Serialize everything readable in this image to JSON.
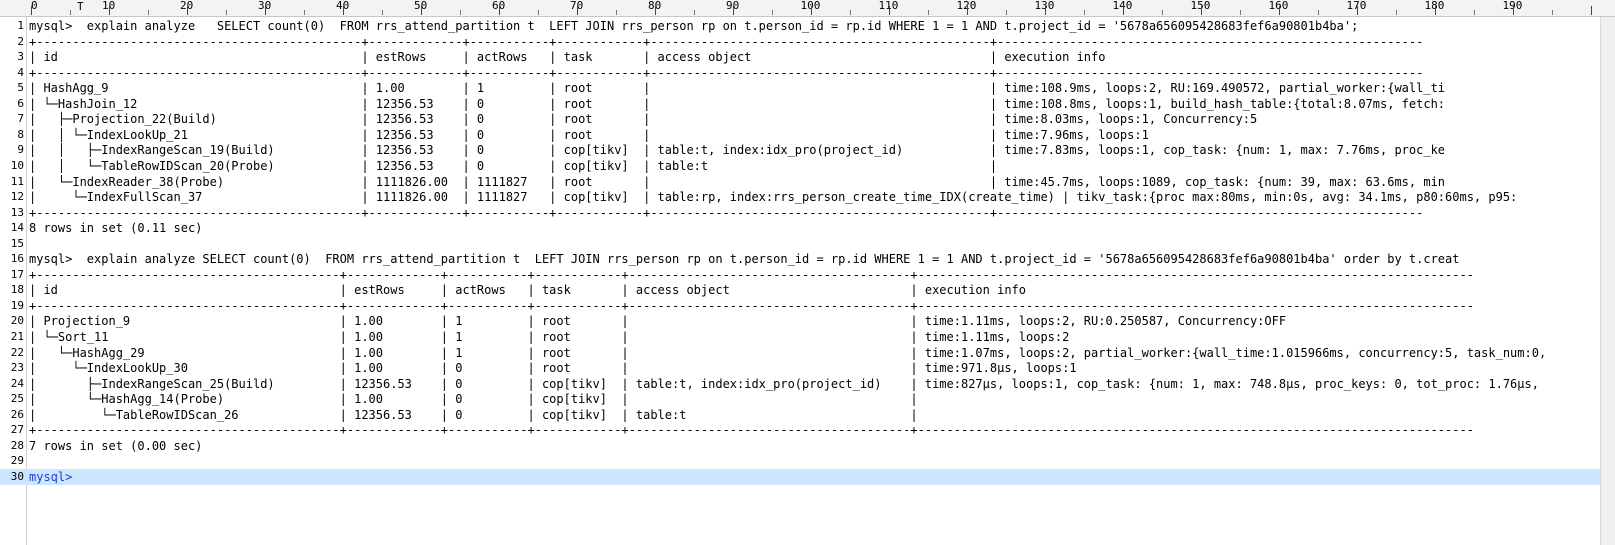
{
  "ruler": {
    "labels": [
      "0",
      "10",
      "20",
      "30",
      "40",
      "50",
      "60",
      "70",
      "80",
      "90",
      "100",
      "110",
      "120",
      "130",
      "140",
      "150",
      "160",
      "170",
      "180",
      "190"
    ],
    "tab_marker": "T"
  },
  "lines": [
    {
      "n": "1",
      "text": "mysql>  explain analyze   SELECT count(0)  FROM rrs_attend_partition t  LEFT JOIN rrs_person rp on t.person_id = rp.id WHERE 1 = 1 AND t.project_id = '5678a656095428683fef6a90801b4ba';"
    },
    {
      "n": "2",
      "text": "+---------------------------------------------+-------------+-----------+------------+-----------------------------------------------+-----------------------------------------------------------"
    },
    {
      "n": "3",
      "text": "| id                                          | estRows     | actRows   | task       | access object                                 | execution info"
    },
    {
      "n": "4",
      "text": "+---------------------------------------------+-------------+-----------+------------+-----------------------------------------------+-----------------------------------------------------------"
    },
    {
      "n": "5",
      "text": "| HashAgg_9                                   | 1.00        | 1         | root       |                                               | time:108.9ms, loops:2, RU:169.490572, partial_worker:{wall_ti"
    },
    {
      "n": "6",
      "text": "| └─HashJoin_12                               | 12356.53    | 0         | root       |                                               | time:108.8ms, loops:1, build_hash_table:{total:8.07ms, fetch:"
    },
    {
      "n": "7",
      "text": "|   ├─Projection_22(Build)                    | 12356.53    | 0         | root       |                                               | time:8.03ms, loops:1, Concurrency:5"
    },
    {
      "n": "8",
      "text": "|   │ └─IndexLookUp_21                        | 12356.53    | 0         | root       |                                               | time:7.96ms, loops:1"
    },
    {
      "n": "9",
      "text": "|   │   ├─IndexRangeScan_19(Build)            | 12356.53    | 0         | cop[tikv]  | table:t, index:idx_pro(project_id)            | time:7.83ms, loops:1, cop_task: {num: 1, max: 7.76ms, proc_ke"
    },
    {
      "n": "10",
      "text": "|   │   └─TableRowIDScan_20(Probe)            | 12356.53    | 0         | cop[tikv]  | table:t                                       |"
    },
    {
      "n": "11",
      "text": "|   └─IndexReader_38(Probe)                   | 1111826.00  | 1111827   | root       |                                               | time:45.7ms, loops:1089, cop_task: {num: 39, max: 63.6ms, min"
    },
    {
      "n": "12",
      "text": "|     └─IndexFullScan_37                      | 1111826.00  | 1111827   | cop[tikv]  | table:rp, index:rrs_person_create_time_IDX(create_time) | tikv_task:{proc max:80ms, min:0s, avg: 34.1ms, p80:60ms, p95:"
    },
    {
      "n": "13",
      "text": "+---------------------------------------------+-------------+-----------+------------+-----------------------------------------------+-----------------------------------------------------------"
    },
    {
      "n": "14",
      "text": "8 rows in set (0.11 sec)"
    },
    {
      "n": "15",
      "text": ""
    },
    {
      "n": "16",
      "text": "mysql>  explain analyze SELECT count(0)  FROM rrs_attend_partition t  LEFT JOIN rrs_person rp on t.person_id = rp.id WHERE 1 = 1 AND t.project_id = '5678a656095428683fef6a90801b4ba' order by t.creat"
    },
    {
      "n": "17",
      "text": "+------------------------------------------+-------------+-----------+------------+---------------------------------------+-----------------------------------------------------------------------------"
    },
    {
      "n": "18",
      "text": "| id                                       | estRows     | actRows   | task       | access object                         | execution info"
    },
    {
      "n": "19",
      "text": "+------------------------------------------+-------------+-----------+------------+---------------------------------------+-----------------------------------------------------------------------------"
    },
    {
      "n": "20",
      "text": "| Projection_9                             | 1.00        | 1         | root       |                                       | time:1.11ms, loops:2, RU:0.250587, Concurrency:OFF"
    },
    {
      "n": "21",
      "text": "| └─Sort_11                                | 1.00        | 1         | root       |                                       | time:1.11ms, loops:2"
    },
    {
      "n": "22",
      "text": "|   └─HashAgg_29                           | 1.00        | 1         | root       |                                       | time:1.07ms, loops:2, partial_worker:{wall_time:1.015966ms, concurrency:5, task_num:0,"
    },
    {
      "n": "23",
      "text": "|     └─IndexLookUp_30                     | 1.00        | 0         | root       |                                       | time:971.8µs, loops:1"
    },
    {
      "n": "24",
      "text": "|       ├─IndexRangeScan_25(Build)         | 12356.53    | 0         | cop[tikv]  | table:t, index:idx_pro(project_id)    | time:827µs, loops:1, cop_task: {num: 1, max: 748.8µs, proc_keys: 0, tot_proc: 1.76µs,"
    },
    {
      "n": "25",
      "text": "|       └─HashAgg_14(Probe)                | 1.00        | 0         | cop[tikv]  |                                       |"
    },
    {
      "n": "26",
      "text": "|         └─TableRowIDScan_26              | 12356.53    | 0         | cop[tikv]  | table:t                               |"
    },
    {
      "n": "27",
      "text": "+------------------------------------------+-------------+-----------+------------+---------------------------------------+-----------------------------------------------------------------------------"
    },
    {
      "n": "28",
      "text": "7 rows in set (0.00 sec)"
    },
    {
      "n": "29",
      "text": ""
    },
    {
      "n": "30",
      "text": "mysql>"
    }
  ],
  "current_line_index": 29
}
